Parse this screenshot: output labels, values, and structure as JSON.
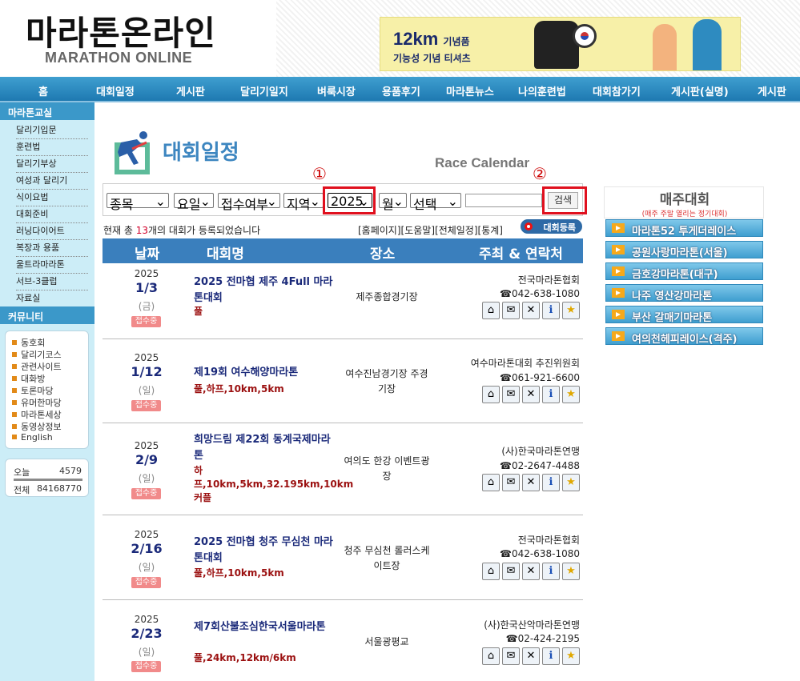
{
  "header": {
    "logo_korean": "마라톤온라인",
    "logo_english": "MARATHON ONLINE",
    "ad": {
      "big": "12km",
      "big_suffix": "기념품",
      "sub": "기능성 기념 티셔츠"
    }
  },
  "nav": {
    "items": [
      "홈",
      "대회일정",
      "게시판",
      "달리기일지",
      "벼룩시장",
      "용품후기",
      "마라톤뉴스",
      "나의훈련법",
      "대회참가기",
      "게시판(실명)",
      "게시판"
    ]
  },
  "sidebar": {
    "section1_title": "마라톤교실",
    "menu": [
      "달리기입문",
      "훈련법",
      "달리기부상",
      "여성과 달리기",
      "식이요법",
      "대회준비",
      "러닝다이어트",
      "복장과 용품",
      "울트라마라톤",
      "서브-3클럽",
      "자료실"
    ],
    "section2_title": "커뮤니티",
    "community": [
      "동호회",
      "달리기코스",
      "관련사이트",
      "대화방",
      "토론마당",
      "유머한마당",
      "마라톤세상",
      "동영상정보",
      "English"
    ],
    "stats": {
      "today_label": "오늘",
      "today_value": "4579",
      "total_label": "전체",
      "total_value": "84168770"
    }
  },
  "main": {
    "title": "대회일정",
    "subtitle": "Race Calendar",
    "markers": [
      "①",
      "②"
    ],
    "search": {
      "selects": [
        "종목",
        "요일",
        "접수여부",
        "지역",
        "2025",
        "월",
        "선택"
      ],
      "input_value": "",
      "button": "검색"
    },
    "count_text_prefix": "현재 총 ",
    "count_value": "13",
    "count_text_suffix": "개의 대회가 등록되었습니다",
    "top_links": "[홈페이지][도움말][전체일정][통계]",
    "register_button": "대회등록",
    "table_headers": [
      "날짜",
      "대회명",
      "장소",
      "주최 & 연락처"
    ],
    "rows": [
      {
        "year": "2025",
        "date": "1/3",
        "dow": "(금)",
        "status": "접수중",
        "name": "2025 전마협 제주 4Full 마라톤대회",
        "categories": "풀",
        "place": "제주종합경기장",
        "organizer": "전국마라톤협회",
        "tel": "☎042-638-1080"
      },
      {
        "year": "2025",
        "date": "1/12",
        "dow": "(일)",
        "status": "접수중",
        "name": "제19회 여수해양마라톤",
        "categories": "풀,하프,10km,5km",
        "place": "여수진남경기장 주경기장",
        "organizer": "여수마라톤대회 추진위원회",
        "tel": "☎061-921-6600"
      },
      {
        "year": "2025",
        "date": "2/9",
        "dow": "(일)",
        "status": "접수중",
        "name": "희망드림 제22회 동계국제마라톤",
        "categories": "하프,10km,5km,32.195km,10km커플",
        "place": "여의도 한강 이벤트광장",
        "organizer": "(사)한국마라톤연맹",
        "tel": "☎02-2647-4488"
      },
      {
        "year": "2025",
        "date": "2/16",
        "dow": "(일)",
        "status": "접수중",
        "name": "2025 전마협 청주 무심천 마라톤대회",
        "categories": "풀,하프,10km,5km",
        "place": "청주 무심천 롤러스케이트장",
        "organizer": "전국마라톤협회",
        "tel": "☎042-638-1080"
      },
      {
        "year": "2025",
        "date": "2/23",
        "dow": "(일)",
        "status": "접수중",
        "name": "제7회산불조심한국서울마라톤",
        "categories": "풀,24km,12km/6km",
        "place": "서울광평교",
        "organizer": "(사)한국산악마라톤연맹",
        "tel": "☎02-424-2195"
      }
    ],
    "row_icons": [
      "home-icon",
      "mail-icon",
      "tools-icon",
      "info-icon",
      "star-icon"
    ]
  },
  "right": {
    "title": "매주대회",
    "subtitle": "(매주 주말 열리는 정기대회)",
    "items": [
      "마라톤52 투게더레이스",
      "공원사랑마라톤(서울)",
      "금호강마라톤(대구)",
      "나주 영산강마라톤",
      "부산 갈매기마라톤",
      "여의천헤피레이스(격주)"
    ]
  }
}
